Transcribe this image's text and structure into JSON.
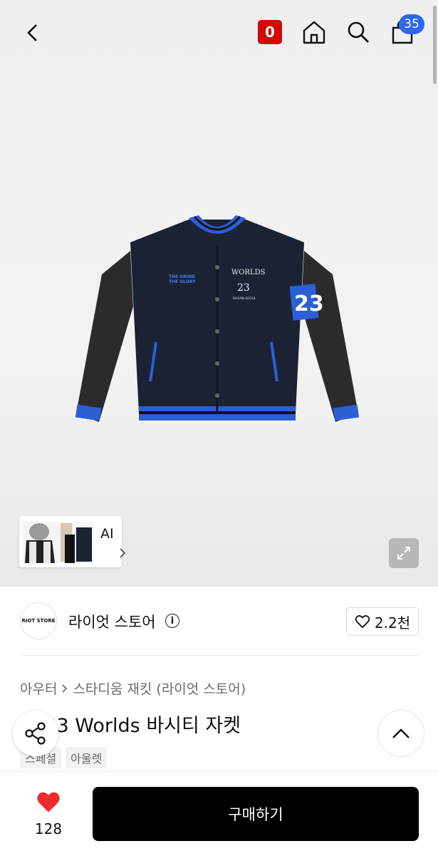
{
  "header": {
    "back_icon": "chevron-left-icon",
    "oco_badge": "0",
    "home_icon": "home-icon",
    "search_icon": "search-icon",
    "cart_icon": "shopping-bag-icon",
    "cart_count": "35"
  },
  "gallery": {
    "thumbnail_label": "AI",
    "expand_icon": "expand-icon"
  },
  "shop": {
    "logo_text": "RIOT STORE",
    "name": "라이엇 스토어",
    "info_icon": "i",
    "likes": "2.2천"
  },
  "product": {
    "breadcrumb": [
      "아우터",
      "스타디움 재킷 (라이엇 스토어)"
    ],
    "title": "2023 Worlds 바시티 자켓",
    "tags": [
      "스페셜",
      "아울렛"
    ],
    "jacket_print": {
      "chest_left_1": "THE GRIND",
      "chest_left_2": "THE GLORY",
      "chest_right": "WORLDS",
      "chest_number": "23",
      "chest_sub": "BUSAN-SEOUL",
      "sleeve_number": "23"
    }
  },
  "bottom": {
    "like_count": "128",
    "buy_label": "구매하기"
  },
  "colors": {
    "oco_red": "#d10a0a",
    "badge_blue": "#2f66ef",
    "heart_red": "#ef2b2b",
    "buy_black": "#000000"
  }
}
